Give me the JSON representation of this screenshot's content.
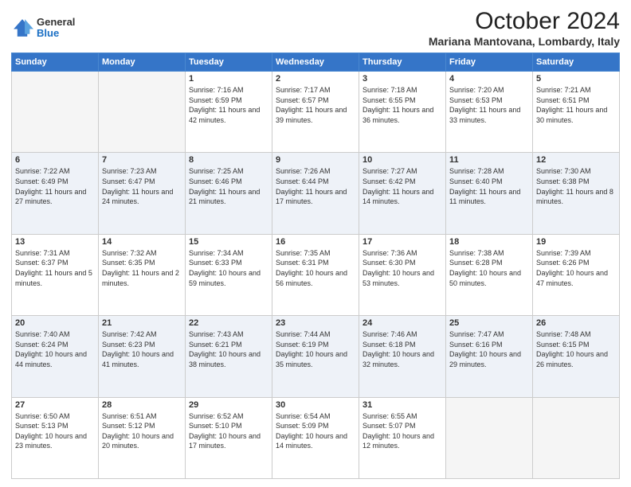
{
  "header": {
    "logo": {
      "general": "General",
      "blue": "Blue"
    },
    "month": "October 2024",
    "location": "Mariana Mantovana, Lombardy, Italy"
  },
  "weekdays": [
    "Sunday",
    "Monday",
    "Tuesday",
    "Wednesday",
    "Thursday",
    "Friday",
    "Saturday"
  ],
  "weeks": [
    [
      {
        "day": "",
        "sunrise": "",
        "sunset": "",
        "daylight": ""
      },
      {
        "day": "",
        "sunrise": "",
        "sunset": "",
        "daylight": ""
      },
      {
        "day": "1",
        "sunrise": "Sunrise: 7:16 AM",
        "sunset": "Sunset: 6:59 PM",
        "daylight": "Daylight: 11 hours and 42 minutes."
      },
      {
        "day": "2",
        "sunrise": "Sunrise: 7:17 AM",
        "sunset": "Sunset: 6:57 PM",
        "daylight": "Daylight: 11 hours and 39 minutes."
      },
      {
        "day": "3",
        "sunrise": "Sunrise: 7:18 AM",
        "sunset": "Sunset: 6:55 PM",
        "daylight": "Daylight: 11 hours and 36 minutes."
      },
      {
        "day": "4",
        "sunrise": "Sunrise: 7:20 AM",
        "sunset": "Sunset: 6:53 PM",
        "daylight": "Daylight: 11 hours and 33 minutes."
      },
      {
        "day": "5",
        "sunrise": "Sunrise: 7:21 AM",
        "sunset": "Sunset: 6:51 PM",
        "daylight": "Daylight: 11 hours and 30 minutes."
      }
    ],
    [
      {
        "day": "6",
        "sunrise": "Sunrise: 7:22 AM",
        "sunset": "Sunset: 6:49 PM",
        "daylight": "Daylight: 11 hours and 27 minutes."
      },
      {
        "day": "7",
        "sunrise": "Sunrise: 7:23 AM",
        "sunset": "Sunset: 6:47 PM",
        "daylight": "Daylight: 11 hours and 24 minutes."
      },
      {
        "day": "8",
        "sunrise": "Sunrise: 7:25 AM",
        "sunset": "Sunset: 6:46 PM",
        "daylight": "Daylight: 11 hours and 21 minutes."
      },
      {
        "day": "9",
        "sunrise": "Sunrise: 7:26 AM",
        "sunset": "Sunset: 6:44 PM",
        "daylight": "Daylight: 11 hours and 17 minutes."
      },
      {
        "day": "10",
        "sunrise": "Sunrise: 7:27 AM",
        "sunset": "Sunset: 6:42 PM",
        "daylight": "Daylight: 11 hours and 14 minutes."
      },
      {
        "day": "11",
        "sunrise": "Sunrise: 7:28 AM",
        "sunset": "Sunset: 6:40 PM",
        "daylight": "Daylight: 11 hours and 11 minutes."
      },
      {
        "day": "12",
        "sunrise": "Sunrise: 7:30 AM",
        "sunset": "Sunset: 6:38 PM",
        "daylight": "Daylight: 11 hours and 8 minutes."
      }
    ],
    [
      {
        "day": "13",
        "sunrise": "Sunrise: 7:31 AM",
        "sunset": "Sunset: 6:37 PM",
        "daylight": "Daylight: 11 hours and 5 minutes."
      },
      {
        "day": "14",
        "sunrise": "Sunrise: 7:32 AM",
        "sunset": "Sunset: 6:35 PM",
        "daylight": "Daylight: 11 hours and 2 minutes."
      },
      {
        "day": "15",
        "sunrise": "Sunrise: 7:34 AM",
        "sunset": "Sunset: 6:33 PM",
        "daylight": "Daylight: 10 hours and 59 minutes."
      },
      {
        "day": "16",
        "sunrise": "Sunrise: 7:35 AM",
        "sunset": "Sunset: 6:31 PM",
        "daylight": "Daylight: 10 hours and 56 minutes."
      },
      {
        "day": "17",
        "sunrise": "Sunrise: 7:36 AM",
        "sunset": "Sunset: 6:30 PM",
        "daylight": "Daylight: 10 hours and 53 minutes."
      },
      {
        "day": "18",
        "sunrise": "Sunrise: 7:38 AM",
        "sunset": "Sunset: 6:28 PM",
        "daylight": "Daylight: 10 hours and 50 minutes."
      },
      {
        "day": "19",
        "sunrise": "Sunrise: 7:39 AM",
        "sunset": "Sunset: 6:26 PM",
        "daylight": "Daylight: 10 hours and 47 minutes."
      }
    ],
    [
      {
        "day": "20",
        "sunrise": "Sunrise: 7:40 AM",
        "sunset": "Sunset: 6:24 PM",
        "daylight": "Daylight: 10 hours and 44 minutes."
      },
      {
        "day": "21",
        "sunrise": "Sunrise: 7:42 AM",
        "sunset": "Sunset: 6:23 PM",
        "daylight": "Daylight: 10 hours and 41 minutes."
      },
      {
        "day": "22",
        "sunrise": "Sunrise: 7:43 AM",
        "sunset": "Sunset: 6:21 PM",
        "daylight": "Daylight: 10 hours and 38 minutes."
      },
      {
        "day": "23",
        "sunrise": "Sunrise: 7:44 AM",
        "sunset": "Sunset: 6:19 PM",
        "daylight": "Daylight: 10 hours and 35 minutes."
      },
      {
        "day": "24",
        "sunrise": "Sunrise: 7:46 AM",
        "sunset": "Sunset: 6:18 PM",
        "daylight": "Daylight: 10 hours and 32 minutes."
      },
      {
        "day": "25",
        "sunrise": "Sunrise: 7:47 AM",
        "sunset": "Sunset: 6:16 PM",
        "daylight": "Daylight: 10 hours and 29 minutes."
      },
      {
        "day": "26",
        "sunrise": "Sunrise: 7:48 AM",
        "sunset": "Sunset: 6:15 PM",
        "daylight": "Daylight: 10 hours and 26 minutes."
      }
    ],
    [
      {
        "day": "27",
        "sunrise": "Sunrise: 6:50 AM",
        "sunset": "Sunset: 5:13 PM",
        "daylight": "Daylight: 10 hours and 23 minutes."
      },
      {
        "day": "28",
        "sunrise": "Sunrise: 6:51 AM",
        "sunset": "Sunset: 5:12 PM",
        "daylight": "Daylight: 10 hours and 20 minutes."
      },
      {
        "day": "29",
        "sunrise": "Sunrise: 6:52 AM",
        "sunset": "Sunset: 5:10 PM",
        "daylight": "Daylight: 10 hours and 17 minutes."
      },
      {
        "day": "30",
        "sunrise": "Sunrise: 6:54 AM",
        "sunset": "Sunset: 5:09 PM",
        "daylight": "Daylight: 10 hours and 14 minutes."
      },
      {
        "day": "31",
        "sunrise": "Sunrise: 6:55 AM",
        "sunset": "Sunset: 5:07 PM",
        "daylight": "Daylight: 10 hours and 12 minutes."
      },
      {
        "day": "",
        "sunrise": "",
        "sunset": "",
        "daylight": ""
      },
      {
        "day": "",
        "sunrise": "",
        "sunset": "",
        "daylight": ""
      }
    ]
  ]
}
